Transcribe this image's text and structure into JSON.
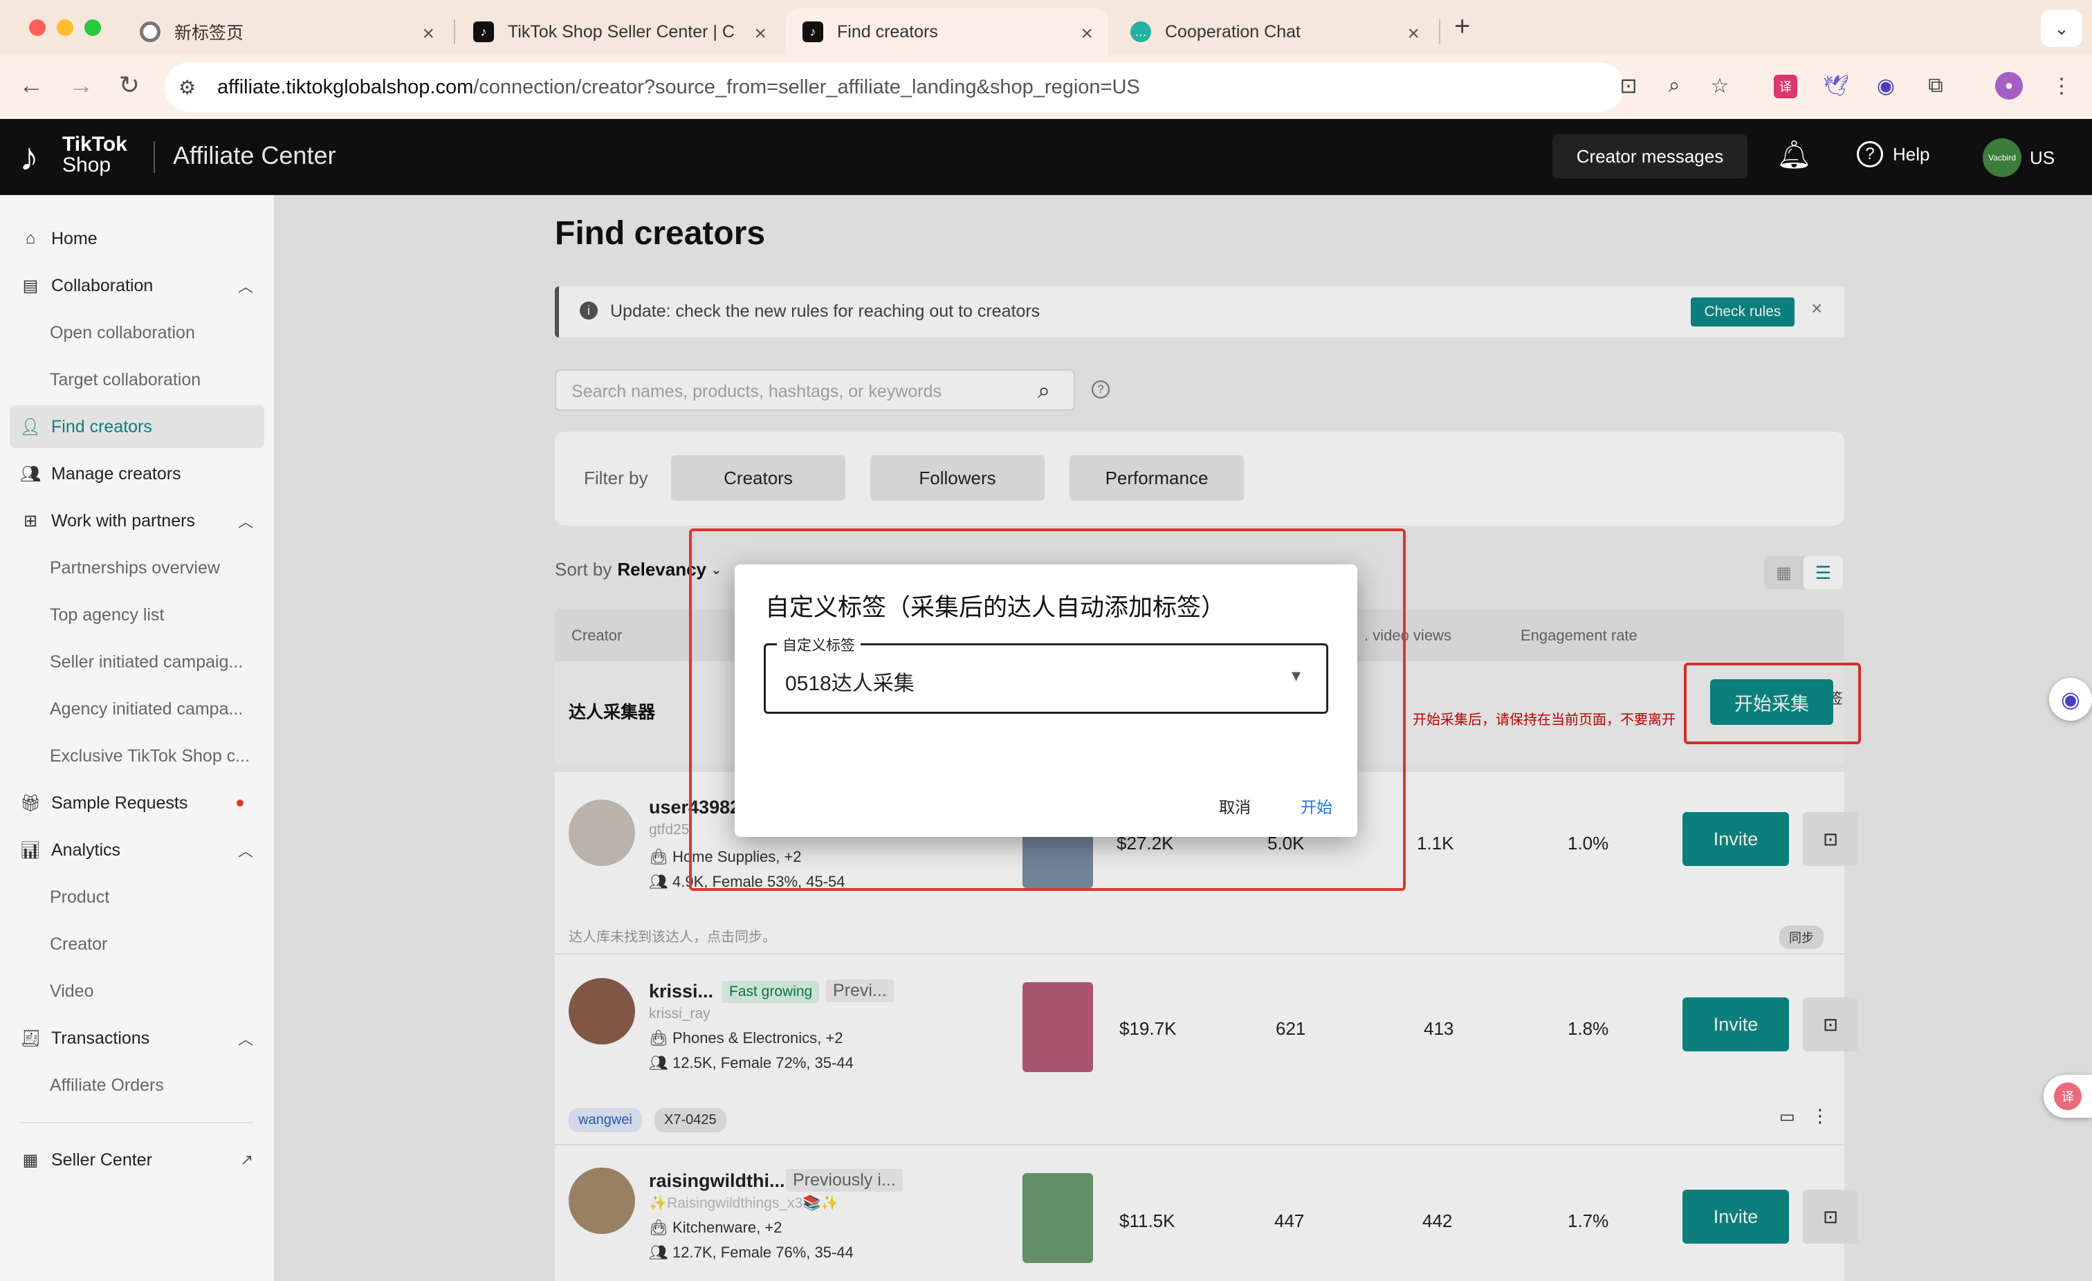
{
  "browser": {
    "tabs": [
      {
        "label": "新标签页",
        "icon": "chrome-icon"
      },
      {
        "label": "TikTok Shop Seller Center | C",
        "icon": "tiktok-icon"
      },
      {
        "label": "Find creators",
        "icon": "tiktok-icon"
      },
      {
        "label": "Cooperation Chat",
        "icon": "chat-icon"
      }
    ],
    "new_tab": "+",
    "url_host": "affiliate.tiktokglobalshop.com",
    "url_path": "/connection/creator?source_from=seller_affiliate_landing&shop_region=US"
  },
  "header": {
    "logo_line1": "TikTok",
    "logo_line2": "Shop",
    "app_title": "Affiliate Center",
    "creator_messages": "Creator messages",
    "help": "Help",
    "avatar_text": "Vacbird",
    "region": "US"
  },
  "sidebar": {
    "home": "Home",
    "collaboration": "Collaboration",
    "open_collab": "Open collaboration",
    "target_collab": "Target collaboration",
    "find_creators": "Find creators",
    "manage_creators": "Manage creators",
    "work_with_partners": "Work with partners",
    "partnerships_overview": "Partnerships overview",
    "top_agency": "Top agency list",
    "seller_campaign": "Seller initiated campaig...",
    "agency_campaign": "Agency initiated campa...",
    "exclusive": "Exclusive TikTok Shop c...",
    "sample_requests": "Sample Requests",
    "analytics": "Analytics",
    "product": "Product",
    "creator": "Creator",
    "video": "Video",
    "transactions": "Transactions",
    "affiliate_orders": "Affiliate Orders",
    "seller_center": "Seller Center"
  },
  "main": {
    "title": "Find creators",
    "banner_text": "Update: check the new rules for reaching out to creators",
    "check_rules": "Check rules",
    "search_placeholder": "Search names, products, hashtags, or keywords",
    "filter_by": "Filter by",
    "filters": [
      "Creators",
      "Followers",
      "Performance"
    ],
    "sort_by": "Sort by",
    "sort_value": "Relevancy",
    "columns": {
      "creator": "Creator",
      "video_views": ". video views",
      "engagement": "Engagement rate"
    },
    "collector": {
      "label": "达人采集器",
      "status": "未自定义标签",
      "warning": "开始采集后，请保持在当前页面，不要离开",
      "start": "开始采集"
    },
    "creators": [
      {
        "name": "user43982",
        "handle": "gtfd25",
        "category": "Home Supplies, +2",
        "demo": "4.9K, Female 53%, 45-54",
        "gmv": "$27.2K",
        "views": "5.0K",
        "avg": "1.1K",
        "engagement": "1.0%",
        "invite": "Invite"
      },
      {
        "name": "krissi...",
        "badge": "Fast growing",
        "prev": "Previ...",
        "handle": "krissi_ray",
        "category": "Phones & Electronics, +2",
        "demo": "12.5K, Female 72%, 35-44",
        "gmv": "$19.7K",
        "views": "621",
        "avg": "413",
        "engagement": "1.8%",
        "invite": "Invite",
        "tags": [
          "wangwei",
          "X7-0425"
        ]
      },
      {
        "name": "raisingwildthi...",
        "prev": "Previously i...",
        "handle": "✨Raisingwildthings_x3📚✨",
        "category": "Kitchenware, +2",
        "demo": "12.7K, Female 76%, 35-44",
        "gmv": "$11.5K",
        "views": "447",
        "avg": "442",
        "engagement": "1.7%",
        "invite": "Invite"
      }
    ],
    "sync_note": "达人库未找到该达人，点击同步。",
    "sync_btn": "同步"
  },
  "dialog": {
    "title": "自定义标签（采集后的达人自动添加标签）",
    "field_label": "自定义标签",
    "field_value": "0518达人采集",
    "cancel": "取消",
    "start": "开始"
  },
  "colors": {
    "accent": "#0b8a86",
    "danger": "#e0352b",
    "link": "#1a73e8"
  }
}
